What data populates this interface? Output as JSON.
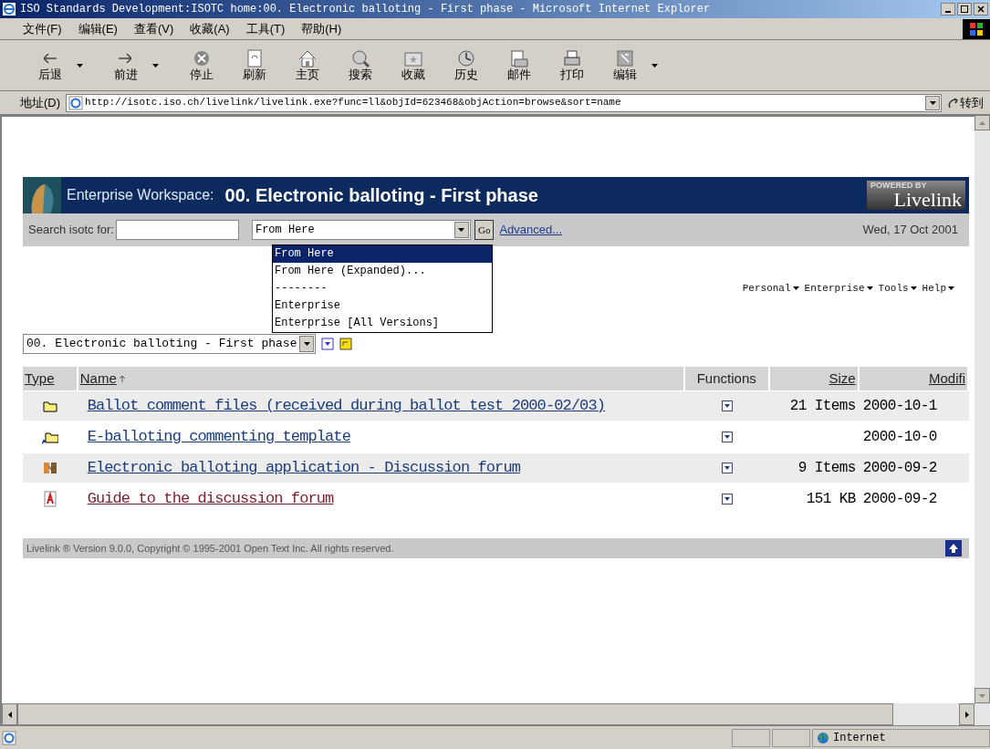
{
  "window": {
    "title": "ISO Standards Development:ISOTC home:00. Electronic balloting - First phase - Microsoft Internet Explorer"
  },
  "menu": [
    "文件(F)",
    "编辑(E)",
    "查看(V)",
    "收藏(A)",
    "工具(T)",
    "帮助(H)"
  ],
  "toolbar": [
    {
      "label": "后退",
      "dropdown": true
    },
    {
      "label": "前进",
      "dropdown": true
    },
    {
      "label": "停止",
      "dropdown": false
    },
    {
      "label": "刷新",
      "dropdown": false
    },
    {
      "label": "主页",
      "dropdown": false
    },
    {
      "label": "搜索",
      "dropdown": false
    },
    {
      "label": "收藏",
      "dropdown": false
    },
    {
      "label": "历史",
      "dropdown": false
    },
    {
      "label": "邮件",
      "dropdown": false
    },
    {
      "label": "打印",
      "dropdown": false
    },
    {
      "label": "编辑",
      "dropdown": true
    }
  ],
  "address": {
    "label": "地址(D)",
    "value": "http://isotc.iso.ch/livelink/livelink.exe?func=ll&objId=623468&objAction=browse&sort=name",
    "go": "转到"
  },
  "header": {
    "prefix": "Enterprise Workspace:",
    "title": "00. Electronic balloting - First phase",
    "powered": "POWERED BY",
    "brand": "Livelink"
  },
  "search": {
    "label": "Search isotc for:",
    "scope": "From Here",
    "go": "Go",
    "advanced": "Advanced...",
    "date": "Wed, 17 Oct 2001"
  },
  "scope_options": [
    {
      "label": "From Here",
      "selected": true
    },
    {
      "label": "From Here (Expanded)...",
      "selected": false
    },
    {
      "label": "--------",
      "selected": false
    },
    {
      "label": "Enterprise",
      "selected": false
    },
    {
      "label": "Enterprise [All Versions]",
      "selected": false
    }
  ],
  "global_menus": [
    "Personal",
    "Enterprise",
    "Tools",
    "Help"
  ],
  "location": "00. Electronic balloting - First phase",
  "table": {
    "columns": [
      "Type",
      "Name",
      "Functions",
      "Size",
      "Modifi"
    ],
    "rows": [
      {
        "kind": "folder",
        "name": "Ballot comment files (received during ballot test 2000-02/03)",
        "visited": false,
        "size": "21 Items",
        "modified": "2000-10-1"
      },
      {
        "kind": "shortcut",
        "name": "E-balloting commenting template",
        "visited": false,
        "size": "",
        "modified": "2000-10-0"
      },
      {
        "kind": "discussion",
        "name": "Electronic balloting application - Discussion forum",
        "visited": false,
        "size": "9 Items",
        "modified": "2000-09-2"
      },
      {
        "kind": "pdf",
        "name": "Guide to the discussion forum",
        "visited": true,
        "size": "151 KB",
        "modified": "2000-09-2"
      }
    ]
  },
  "footer": "Livelink ® Version 9.0.0, Copyright © 1995-2001 Open Text Inc. All rights reserved.",
  "status_bar": {
    "zone": "Internet"
  }
}
